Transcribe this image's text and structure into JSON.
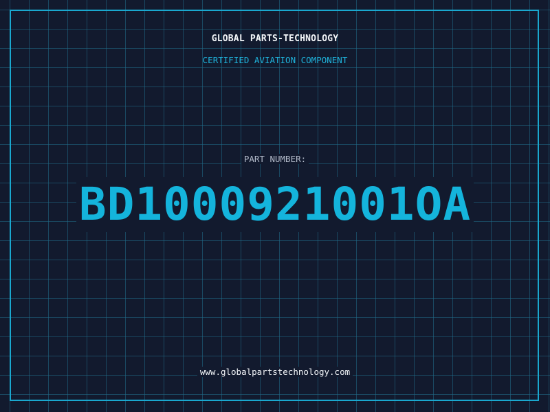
{
  "header": {
    "brand": "GLOBAL PARTS-TECHNOLOGY",
    "certification": "CERTIFIED AVIATION COMPONENT"
  },
  "part": {
    "label": "PART NUMBER:",
    "number": "BD1000921001OA"
  },
  "footer": {
    "website": "www.globalpartstechnology.com"
  },
  "colors": {
    "background": "#121a2e",
    "grid": "#206e8a",
    "accent": "#14b4dc",
    "text": "#f2f5f8"
  }
}
